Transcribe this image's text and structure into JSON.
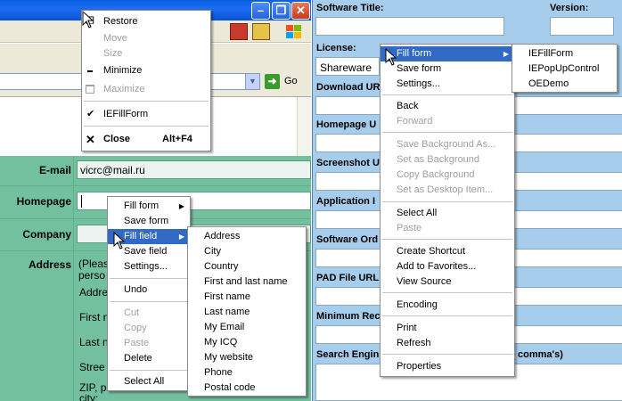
{
  "system_menu": {
    "items": [
      {
        "label": "Restore",
        "disabled": false
      },
      {
        "label": "Move",
        "disabled": true
      },
      {
        "label": "Size",
        "disabled": true
      },
      {
        "label": "Minimize",
        "disabled": false
      },
      {
        "label": "Maximize",
        "disabled": true
      },
      {
        "label": "IEFillForm",
        "disabled": false
      },
      {
        "label": "Close",
        "shortcut": "Alt+F4",
        "disabled": false
      }
    ]
  },
  "address_bar": {
    "go_label": "Go"
  },
  "left_form": {
    "email_label": "E-mail",
    "email_value": "vicrc@mail.ru",
    "homepage_label": "Homepage",
    "company_label": "Company",
    "address_label": "Address",
    "address_hint_1": "(Pleas",
    "address_hint_2": "perso",
    "sub_labels": [
      "Addre",
      "First n",
      "Last n",
      "Stree",
      "ZIP, p",
      "city:"
    ]
  },
  "left_context_menu": {
    "items": [
      {
        "label": "Fill form",
        "submenu": true
      },
      {
        "label": "Save form"
      },
      {
        "label": "Fill field",
        "submenu": true,
        "highlighted": true
      },
      {
        "label": "Save field"
      },
      {
        "label": "Settings..."
      },
      {
        "label": "Undo"
      },
      {
        "label": "Cut",
        "disabled": true
      },
      {
        "label": "Copy",
        "disabled": true
      },
      {
        "label": "Paste",
        "disabled": true
      },
      {
        "label": "Delete"
      },
      {
        "label": "Select All"
      }
    ]
  },
  "fill_field_submenu": {
    "items": [
      "Address",
      "City",
      "Country",
      "First and last name",
      "First name",
      "Last name",
      "My Email",
      "My ICQ",
      "My website",
      "Phone",
      "Postal code"
    ]
  },
  "right_form": {
    "software_title_label": "Software Title:",
    "version_label": "Version:",
    "license_label": "License:",
    "license_value": "Shareware",
    "download_label": "Download UR",
    "homepage_label": "Homepage U",
    "screenshot_label": "Screenshot U",
    "application_label": "Application I",
    "software_order_label": "Software Ord",
    "pad_label": "PAD File URL",
    "minimum_label": "Minimum Rec",
    "search_label": "Search Engin",
    "search_suffix": "comma's)"
  },
  "right_context_menu": {
    "items": [
      {
        "label": "Fill form",
        "submenu": true,
        "highlighted": true
      },
      {
        "label": "Save form"
      },
      {
        "label": "Settings..."
      },
      {
        "label": "Back"
      },
      {
        "label": "Forward",
        "disabled": true
      },
      {
        "label": "Save Background As...",
        "disabled": true
      },
      {
        "label": "Set as Background",
        "disabled": true
      },
      {
        "label": "Copy Background",
        "disabled": true
      },
      {
        "label": "Set as Desktop Item...",
        "disabled": true
      },
      {
        "label": "Select All"
      },
      {
        "label": "Paste",
        "disabled": true
      },
      {
        "label": "Create Shortcut"
      },
      {
        "label": "Add to Favorites..."
      },
      {
        "label": "View Source"
      },
      {
        "label": "Encoding"
      },
      {
        "label": "Print"
      },
      {
        "label": "Refresh"
      },
      {
        "label": "Properties"
      }
    ]
  },
  "fill_form_submenu": {
    "items": [
      "IEFillForm",
      "IEPopUpControl",
      "OEDemo"
    ]
  },
  "colors": {
    "highlight": "#316ac5",
    "form_green": "#73c09f",
    "form_blue": "#a6cdeb",
    "titlebar_blue": "#0a5fe0"
  }
}
